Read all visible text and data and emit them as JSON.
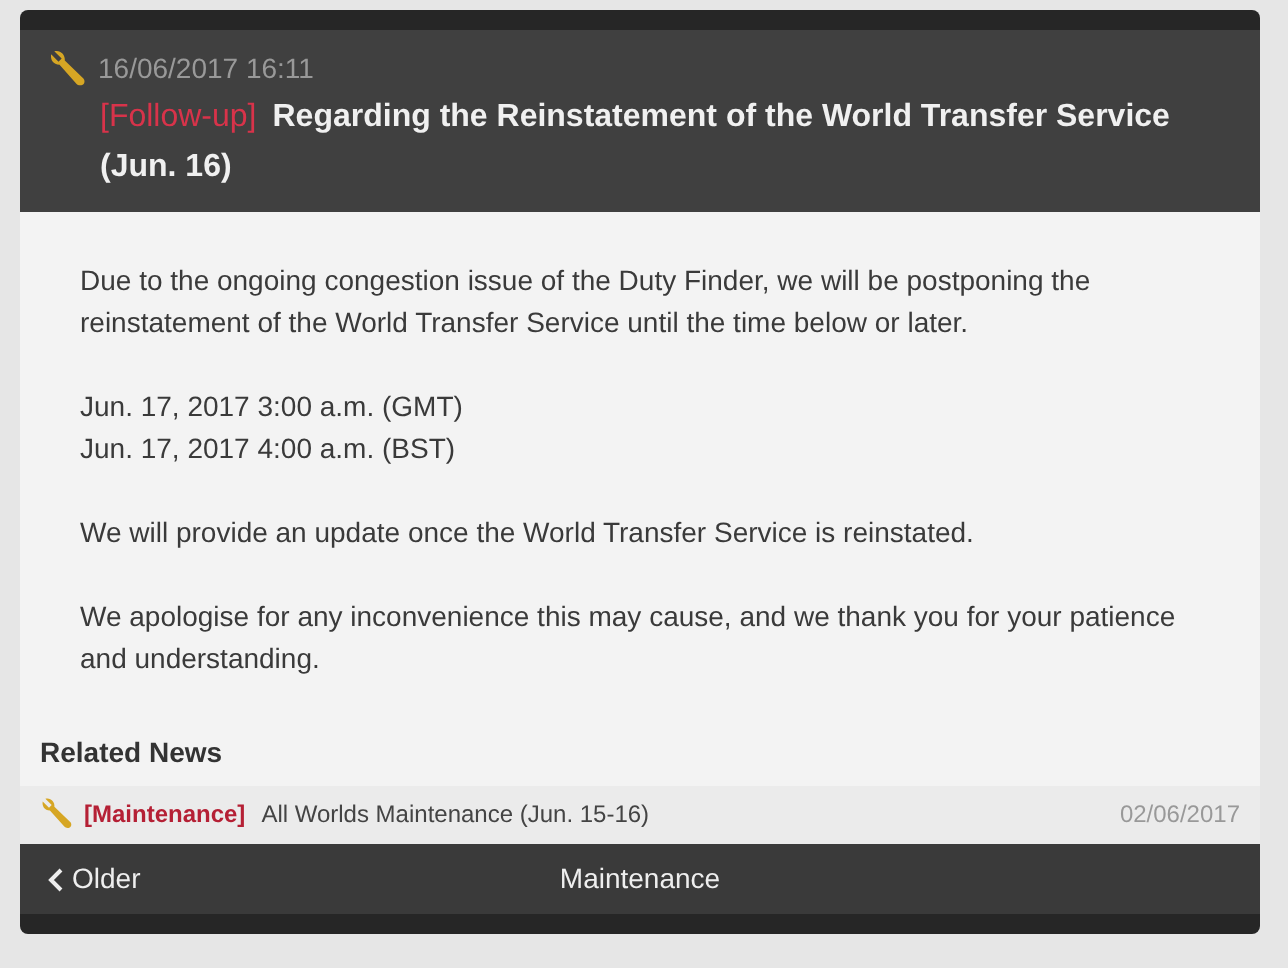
{
  "header": {
    "date": "16/06/2017 16:11",
    "tag": "[Follow-up]",
    "title": "Regarding the Reinstatement of the World Transfer Service (Jun. 16)"
  },
  "body": {
    "paragraphs": [
      [
        "Due to the ongoing congestion issue of the Duty Finder, we will be postponing the reinstatement of the World Transfer Service until the time below or later."
      ],
      [
        "Jun. 17, 2017 3:00 a.m. (GMT)",
        "Jun. 17, 2017 4:00 a.m. (BST)"
      ],
      [
        "We will provide an update once the World Transfer Service is reinstated."
      ],
      [
        "We apologise for any inconvenience this may cause, and we thank you for your patience and understanding."
      ]
    ]
  },
  "related": {
    "heading": "Related News",
    "items": [
      {
        "tag": "[Maintenance]",
        "title": "All Worlds Maintenance (Jun. 15-16)",
        "date": "02/06/2017"
      }
    ]
  },
  "footer": {
    "back": "Older",
    "category": "Maintenance"
  }
}
